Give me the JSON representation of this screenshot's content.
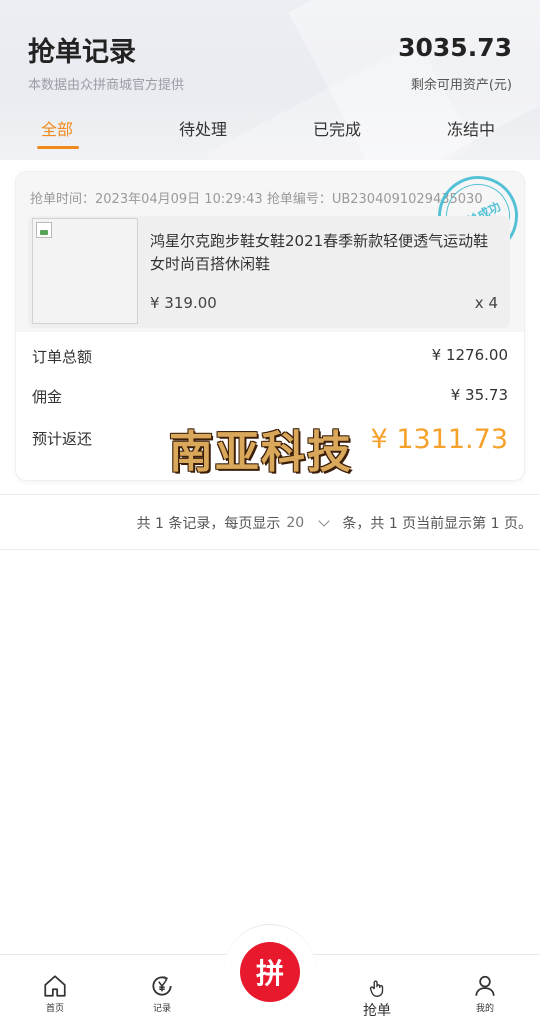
{
  "header": {
    "title": "抢单记录",
    "subtitle": "本数据由众拼商城官方提供",
    "balance": "3035.73",
    "balance_label": "剩余可用资产(元)"
  },
  "tabs": [
    {
      "label": "全部",
      "active": true
    },
    {
      "label": "待处理",
      "active": false
    },
    {
      "label": "已完成",
      "active": false
    },
    {
      "label": "冻结中",
      "active": false
    }
  ],
  "order": {
    "meta": "抢单时间：2023年04月09日 10:29:43 抢单编号：UB2304091029435030",
    "stamp": "抢单成功",
    "product_name": "鸿星尔克跑步鞋女鞋2021春季新款轻便透气运动鞋女时尚百搭休闲鞋",
    "price": "¥ 319.00",
    "quantity": "x 4",
    "rows": [
      {
        "label": "订单总额",
        "value": "¥ 1276.00"
      },
      {
        "label": "佣金",
        "value": "¥ 35.73"
      },
      {
        "label": "预计返还",
        "value": "¥ 1311.73"
      }
    ]
  },
  "watermark": "南亚科技",
  "pagination": {
    "prefix": "共 1 条记录，每页显示",
    "page_size": "20",
    "suffix": "条，共 1 页当前显示第 1 页。"
  },
  "bottom_nav": {
    "home": "首页",
    "records": "记录",
    "center": "拼",
    "grab": "抢单",
    "mine": "我的"
  },
  "colors": {
    "accent": "#f08a1d",
    "highlight_value": "#f5a12a",
    "center_button": "#e8192c",
    "stamp": "#35b8cf"
  }
}
